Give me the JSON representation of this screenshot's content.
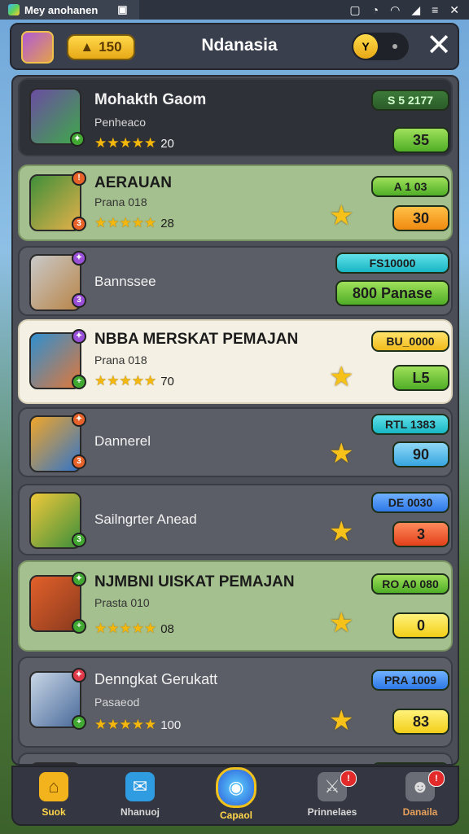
{
  "statusbar": {
    "tab_label": "Mey anohanen"
  },
  "header": {
    "coins": "150",
    "title": "Ndanasia",
    "toggle_label": "Y"
  },
  "rows": [
    {
      "name": "Mohakth Gaom",
      "sub": "Penheaco",
      "rating": "20",
      "stars": 5,
      "pill_top": "S 5 2177",
      "pill_bottom": "35",
      "star_button": false
    },
    {
      "name": "AERAUAN",
      "sub": "Prana 018",
      "rating": "28",
      "stars": 5,
      "pill_top": "A 1 03",
      "pill_bottom": "30",
      "star_button": true
    },
    {
      "name": "Bannssee",
      "sub": "",
      "rating": "",
      "stars": 0,
      "pill_top": "FS10000",
      "pill_bottom": "800 Panase",
      "star_button": false
    },
    {
      "name": "NBBA MERSKAT PEMAJAN",
      "sub": "Prana 018",
      "rating": "70",
      "stars": 5,
      "pill_top": "BU_0000",
      "pill_bottom": "L5",
      "star_button": true
    },
    {
      "name": "Dannerel",
      "sub": "",
      "rating": "",
      "stars": 0,
      "pill_top": "RTL 1383",
      "pill_bottom": "90",
      "star_button": true
    },
    {
      "name": "Sailngrter Anead",
      "sub": "",
      "rating": "",
      "stars": 0,
      "pill_top": "DE 0030",
      "pill_bottom": "3",
      "star_button": true
    },
    {
      "name": "NJMBNI UISKAT PEMAJAN",
      "sub": "Prasta 010",
      "rating": "08",
      "stars": 5,
      "pill_top": "RO A0 080",
      "pill_bottom": "0",
      "star_button": true
    },
    {
      "name": "Denngkat Gerukatt",
      "sub": "Pasaeod",
      "rating": "100",
      "stars": 5,
      "pill_top": "PRA 1009",
      "pill_bottom": "83",
      "star_button": true
    }
  ],
  "nav": [
    {
      "label": "Suok",
      "icon": "home-icon",
      "glyph": "⌂"
    },
    {
      "label": "Nhanuoj",
      "icon": "chat-icon",
      "glyph": "✉"
    },
    {
      "label": "Capaol",
      "icon": "globe-icon",
      "glyph": "◉"
    },
    {
      "label": "Prinnelaes",
      "icon": "helmet-icon",
      "glyph": "⚔"
    },
    {
      "label": "Danaila",
      "icon": "profile-icon",
      "glyph": "☻"
    }
  ]
}
